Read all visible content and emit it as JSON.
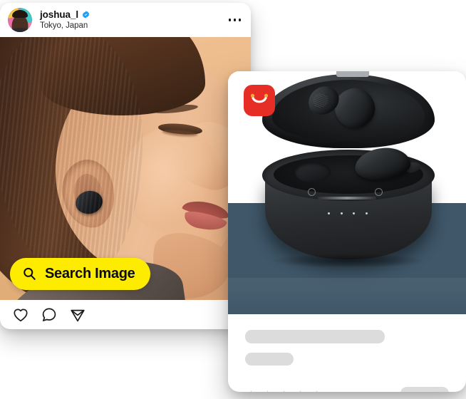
{
  "social_post": {
    "avatar_name": "user-avatar",
    "username": "joshua_l",
    "verified": true,
    "location": "Tokyo, Japan",
    "more_menu_label": "•••",
    "photo_alt": "woman-profile-wearing-earbud",
    "search_button": {
      "label": "Search Image",
      "icon": "search-icon",
      "bg_color": "#FDEC00",
      "text_color": "#0C0C0D"
    },
    "actions": [
      {
        "name": "like-icon",
        "label": "Like"
      },
      {
        "name": "comment-icon",
        "label": "Comment"
      },
      {
        "name": "share-icon",
        "label": "Share"
      }
    ]
  },
  "product_card": {
    "shop_logo": {
      "name": "shopping-bag-logo",
      "bg_color": "#E62E26",
      "accent_color": "#F2A93B"
    },
    "product_image": {
      "alt": "black-wireless-earbuds-in-charging-case",
      "bg_top_color": "#FFFFFF",
      "bg_bottom_color": "#3F5769"
    },
    "skeleton": {
      "title_placeholder": "",
      "subtitle_placeholder": "",
      "button_placeholder": "",
      "placeholder_color": "#DCDCDC"
    },
    "rating": {
      "stars_total": 5,
      "stars_filled": 0,
      "star_color": "#DCDCDC"
    }
  }
}
